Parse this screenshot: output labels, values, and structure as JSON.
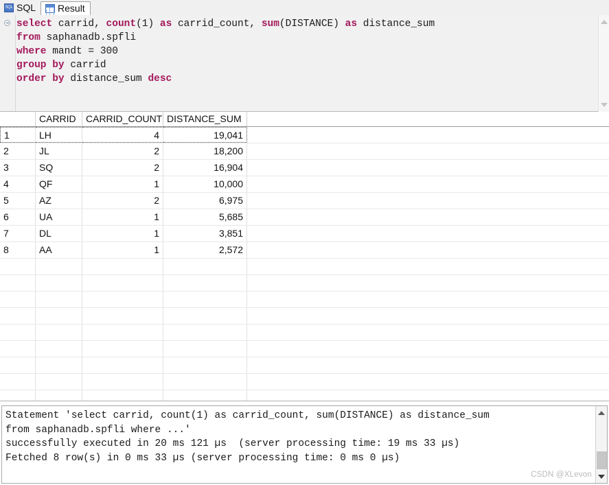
{
  "tabs": [
    {
      "label": "SQL",
      "icon": "sql-badge-icon",
      "active": false
    },
    {
      "label": "Result",
      "icon": "table-grid-icon",
      "active": true
    }
  ],
  "editor": {
    "fold_marker": "⊝",
    "lines": [
      [
        {
          "t": "select",
          "kw": true
        },
        {
          "t": " carrid, ",
          "kw": false
        },
        {
          "t": "count",
          "kw": true
        },
        {
          "t": "(1) ",
          "kw": false
        },
        {
          "t": "as",
          "kw": true
        },
        {
          "t": " carrid_count, ",
          "kw": false
        },
        {
          "t": "sum",
          "kw": true
        },
        {
          "t": "(DISTANCE) ",
          "kw": false
        },
        {
          "t": "as",
          "kw": true
        },
        {
          "t": " distance_sum",
          "kw": false
        }
      ],
      [
        {
          "t": "from",
          "kw": true
        },
        {
          "t": " saphanadb.spfli",
          "kw": false
        }
      ],
      [
        {
          "t": "where",
          "kw": true
        },
        {
          "t": " mandt = 300",
          "kw": false
        }
      ],
      [
        {
          "t": "group by",
          "kw": true
        },
        {
          "t": " carrid",
          "kw": false
        }
      ],
      [
        {
          "t": "order by",
          "kw": true
        },
        {
          "t": " distance_sum ",
          "kw": false
        },
        {
          "t": "desc",
          "kw": true
        }
      ]
    ],
    "keyword_color": "#a31a5b"
  },
  "result_grid": {
    "columns": [
      "",
      "CARRID",
      "CARRID_COUNT",
      "DISTANCE_SUM"
    ],
    "rows": [
      {
        "n": "1",
        "carrid": "LH",
        "carrid_count": "4",
        "distance_sum": "19,041",
        "selected": true
      },
      {
        "n": "2",
        "carrid": "JL",
        "carrid_count": "2",
        "distance_sum": "18,200",
        "selected": false
      },
      {
        "n": "3",
        "carrid": "SQ",
        "carrid_count": "2",
        "distance_sum": "16,904",
        "selected": false
      },
      {
        "n": "4",
        "carrid": "QF",
        "carrid_count": "1",
        "distance_sum": "10,000",
        "selected": false
      },
      {
        "n": "5",
        "carrid": "AZ",
        "carrid_count": "2",
        "distance_sum": "6,975",
        "selected": false
      },
      {
        "n": "6",
        "carrid": "UA",
        "carrid_count": "1",
        "distance_sum": "5,685",
        "selected": false
      },
      {
        "n": "7",
        "carrid": "DL",
        "carrid_count": "1",
        "distance_sum": "3,851",
        "selected": false
      },
      {
        "n": "8",
        "carrid": "AA",
        "carrid_count": "1",
        "distance_sum": "2,572",
        "selected": false
      }
    ],
    "empty_row_count": 9
  },
  "log": {
    "text": "Statement 'select carrid, count(1) as carrid_count, sum(DISTANCE) as distance_sum\nfrom saphanadb.spfli where ...'\nsuccessfully executed in 20 ms 121 µs  (server processing time: 19 ms 33 µs)\nFetched 8 row(s) in 0 ms 33 µs (server processing time: 0 ms 0 µs)"
  },
  "watermark": {
    "text": "CSDN @XLevon"
  },
  "scrollbars": {
    "editor": {
      "up": "scroll-up-arrow",
      "down": "scroll-down-arrow"
    },
    "log": {
      "up": "scroll-up-arrow",
      "down": "scroll-down-arrow"
    }
  }
}
